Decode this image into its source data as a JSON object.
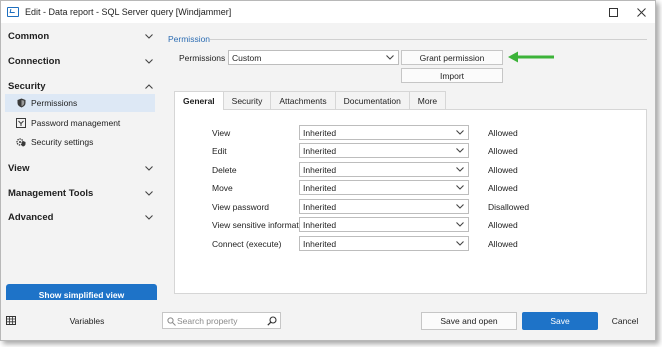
{
  "window": {
    "title": "Edit - Data report - SQL Server query [Windjammer]"
  },
  "sidebar": {
    "sections": [
      {
        "label": "Common",
        "expanded": false
      },
      {
        "label": "Connection",
        "expanded": false
      },
      {
        "label": "Security",
        "expanded": true
      },
      {
        "label": "View",
        "expanded": false
      },
      {
        "label": "Management Tools",
        "expanded": false
      },
      {
        "label": "Advanced",
        "expanded": false
      }
    ],
    "security_items": [
      {
        "label": "Permissions",
        "icon": "shield-icon",
        "active": true
      },
      {
        "label": "Password management",
        "icon": "key-icon",
        "active": false
      },
      {
        "label": "Security settings",
        "icon": "gear-shield-icon",
        "active": false
      }
    ],
    "simplified_button": "Show simplified view"
  },
  "main": {
    "group_title": "Permission",
    "permissions_label": "Permissions",
    "permissions_value": "Custom",
    "grant_button": "Grant permission",
    "import_button": "Import",
    "tabs": [
      "General",
      "Security",
      "Attachments",
      "Documentation",
      "More"
    ],
    "active_tab": "General",
    "rows": [
      {
        "label": "View",
        "value": "Inherited",
        "status": "Allowed"
      },
      {
        "label": "Edit",
        "value": "Inherited",
        "status": "Allowed"
      },
      {
        "label": "Delete",
        "value": "Inherited",
        "status": "Allowed"
      },
      {
        "label": "Move",
        "value": "Inherited",
        "status": "Allowed"
      },
      {
        "label": "View password",
        "value": "Inherited",
        "status": "Disallowed"
      },
      {
        "label": "View sensitive information",
        "value": "Inherited",
        "status": "Allowed"
      },
      {
        "label": "Connect (execute)",
        "value": "Inherited",
        "status": "Allowed"
      }
    ],
    "annotation_arrow_color": "#3cb339"
  },
  "bottom": {
    "variables_button": "Variables",
    "search_placeholder": "Search property",
    "save_and_open": "Save and open",
    "save": "Save",
    "cancel": "Cancel"
  },
  "colors": {
    "accent": "#1e73c8",
    "group_title": "#2d6db3",
    "active_item_bg": "#dde8f5"
  }
}
